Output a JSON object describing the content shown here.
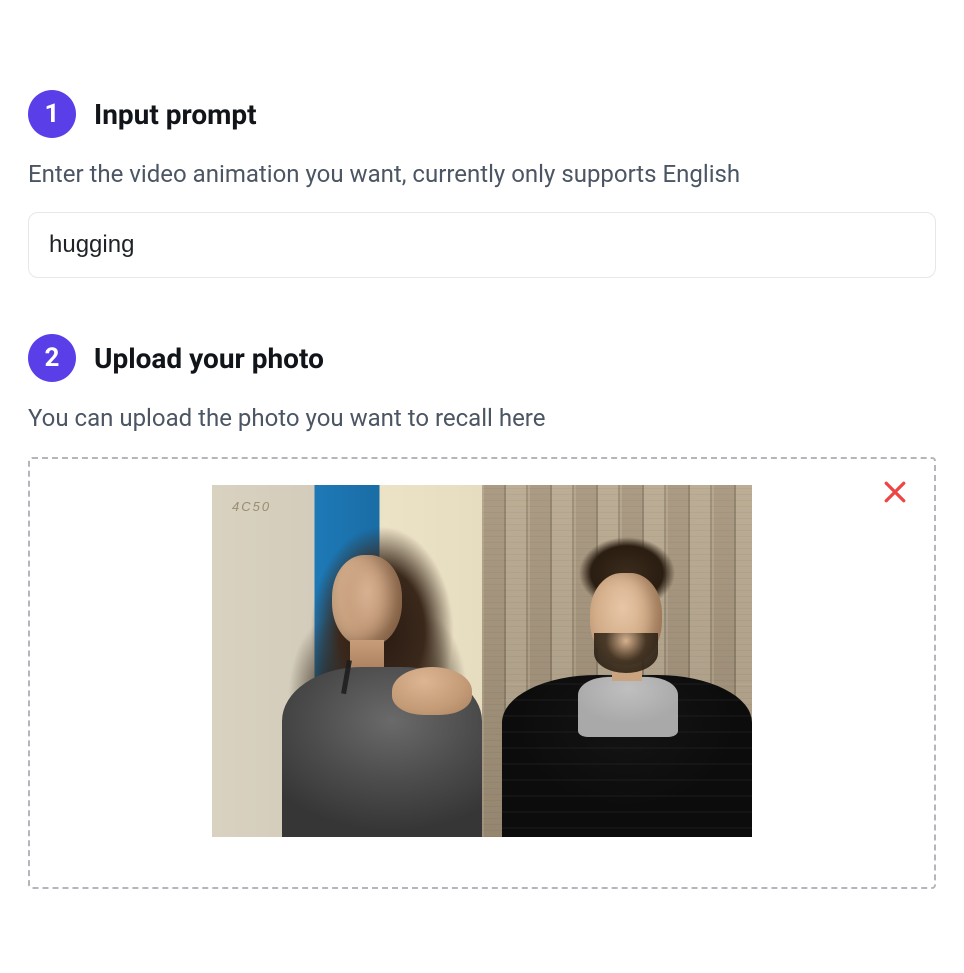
{
  "step1": {
    "number": "1",
    "title": "Input prompt",
    "description": "Enter the video animation you want, currently only supports English",
    "input_value": "hugging",
    "input_placeholder": ""
  },
  "step2": {
    "number": "2",
    "title": "Upload your photo",
    "description": "You can upload the photo you want to recall here"
  },
  "colors": {
    "accent": "#5a3fe8",
    "danger": "#ef4444"
  }
}
